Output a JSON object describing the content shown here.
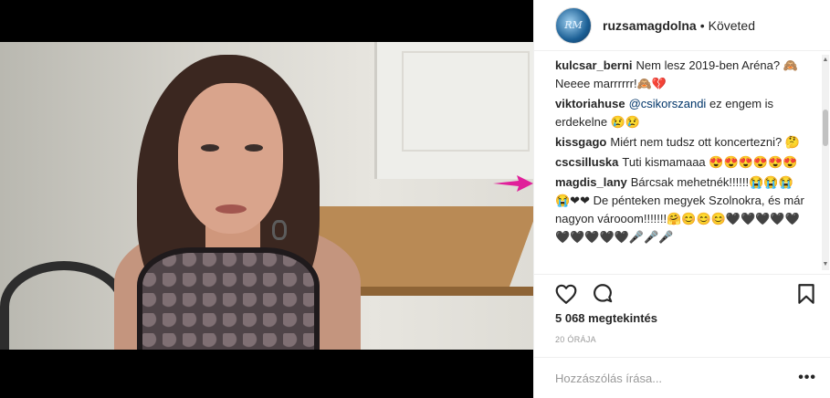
{
  "post": {
    "username": "ruzsamagdolna",
    "separator": "•",
    "follow_status": "Követed",
    "avatar_text": "RM"
  },
  "comments": [
    {
      "user": "kulcsar_berni",
      "text": "Nem lesz 2019-ben Aréna? 🙈 Neeee marrrrrr!🙈💔"
    },
    {
      "user": "viktoriahuse",
      "mention": "@csikorszandi",
      "text": " ez engem is erdekelne 😢😢"
    },
    {
      "user": "kissgago",
      "text": "Miért nem tudsz ott koncertezni? 🤔"
    },
    {
      "user": "cscsilluska",
      "text": "Tuti kismamaaa 😍😍😍😍😍😍"
    },
    {
      "user": "magdis_lany",
      "text": "Bárcsak mehetnék!!!!!!😭😭😭😭❤❤ De pénteken megyek Szolnokra, és már nagyon várooom!!!!!!!🤗😊😊😊🖤🖤🖤🖤🖤🖤🖤🖤🖤🖤🎤🎤🎤"
    }
  ],
  "actions": {
    "like_icon": "heart-outline-icon",
    "comment_icon": "comment-bubble-icon",
    "save_icon": "bookmark-icon"
  },
  "views_text": "5 068 megtekintés",
  "time_text": "20 ÓRÁJA",
  "add_comment": {
    "placeholder": "Hozzászólás írása...",
    "more_label": "•••"
  },
  "colors": {
    "text": "#262626",
    "muted": "#999999",
    "mention": "#003569",
    "arrow": "#e0209a"
  }
}
